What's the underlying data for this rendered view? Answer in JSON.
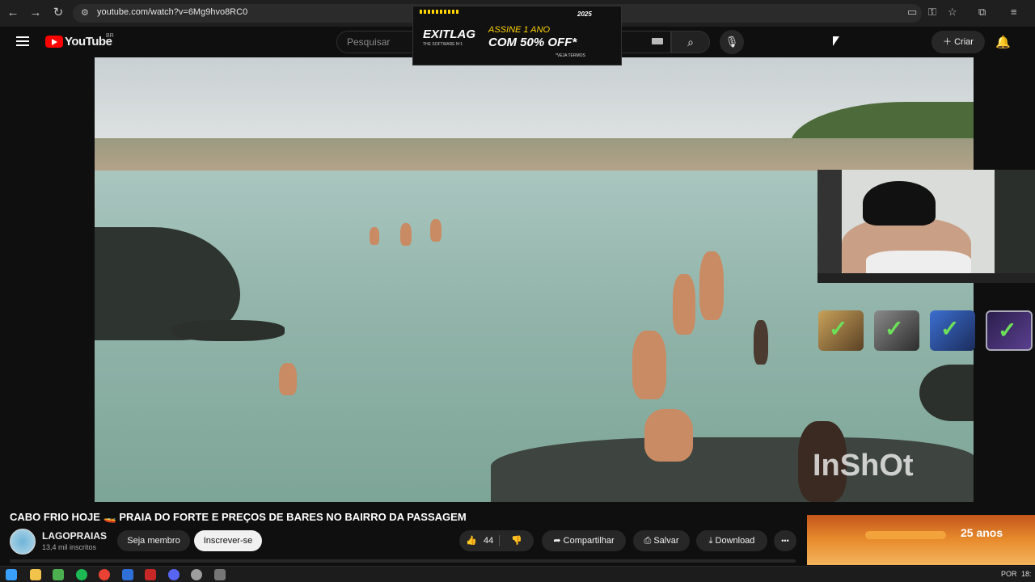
{
  "browser": {
    "url": "youtube.com/watch?v=6Mg9hvo8RC0",
    "back_icon": "←",
    "forward_icon": "→",
    "reload_icon": "↻"
  },
  "header": {
    "logo_text": "YouTube",
    "country_code": "BR",
    "search_placeholder": "Pesquisar",
    "create_label": "Criar"
  },
  "ad": {
    "year_badge": "2025",
    "brand": "EXITLAG",
    "brand_sub": "THE SOFTWARE Nº1",
    "line1": "ASSINE 1 ANO",
    "line2": "COM 50% OFF*",
    "note": "*VEJA TERMOS"
  },
  "video": {
    "watermark": "InShOt"
  },
  "info": {
    "title": "CABO FRIO HOJE 🚤 PRAIA DO FORTE E PREÇOS DE BARES NO BAIRRO DA PASSAGEM",
    "channel": "LAGOPRAIAS",
    "subscribers": "13,4 mil inscritos",
    "member_label": "Seja membro",
    "subscribe_label": "Inscrever-se",
    "likes": "44",
    "share_label": "Compartilhar",
    "save_label": "Salvar",
    "download_label": "Download",
    "more_label": "•••"
  },
  "side_ad": {
    "anniversary": "25 anos"
  },
  "taskbar": {
    "language": "POR",
    "time": "18:"
  },
  "colors": {
    "yt_red": "#ff0000",
    "ad_yellow": "#ffd400",
    "check_green": "#6de05a"
  }
}
